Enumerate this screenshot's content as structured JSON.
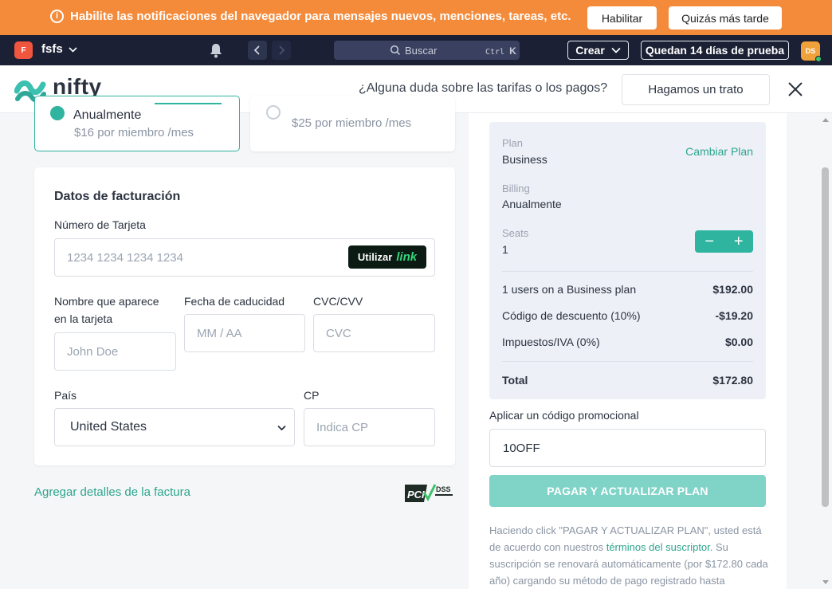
{
  "banner": {
    "icon": "info-icon",
    "message": "Habilite las notificaciones del navegador para mensajes nuevos, menciones, tareas, etc.",
    "enable_label": "Habilitar",
    "later_label": "Quizás más tarde",
    "color": "#f48b3b"
  },
  "topbar": {
    "workspace_initial": "F",
    "workspace_name": "fsfs",
    "search_placeholder": "Buscar",
    "search_shortcut_mod": "Ctrl",
    "search_shortcut_key": "K",
    "create_label": "Crear",
    "trial_label": "Quedan 14 días de prueba",
    "avatar_initials": "DS"
  },
  "header": {
    "logo_text": "nifty",
    "question": "¿Alguna duda sobre las tarifas o los pagos?",
    "deal_label": "Hagamos un trato"
  },
  "plans": {
    "annual": {
      "name": "Anualmente",
      "price": "$16 por miembro /mes",
      "selected": true
    },
    "monthly": {
      "price": "$25 por miembro /mes",
      "selected": false
    }
  },
  "billing": {
    "title": "Datos de facturación",
    "card_label": "Número de Tarjeta",
    "card_placeholder": "1234 1234 1234 1234",
    "link_use": "Utilizar",
    "link_brand": "link",
    "name_label_1": "Nombre que aparece",
    "name_label_2": "en la tarjeta",
    "name_placeholder": "John Doe",
    "expiry_label": "Fecha de caducidad",
    "expiry_placeholder": "MM / AA",
    "cvc_label": "CVC/CVV",
    "cvc_placeholder": "CVC",
    "country_label": "País",
    "country_value": "United States",
    "zip_label": "CP",
    "zip_placeholder": "Indica CP"
  },
  "invoice_link": "Agregar detalles de la factura",
  "pci_badge": {
    "pci": "PCI",
    "dss": "DSS"
  },
  "summary": {
    "plan_label": "Plan",
    "plan_value": "Business",
    "change_plan": "Cambiar Plan",
    "billing_label": "Billing",
    "billing_value": "Anualmente",
    "seats_label": "Seats",
    "seats_value": "1",
    "stepper_minus": "−",
    "stepper_plus": "+",
    "rows": [
      {
        "label": "1 users on a Business plan",
        "value": "$192.00"
      },
      {
        "label": "Código de descuento (10%)",
        "value": "-$19.20"
      },
      {
        "label": "Impuestos/IVA (0%)",
        "value": "$0.00"
      }
    ],
    "total_label": "Total",
    "total_value": "$172.80"
  },
  "promo": {
    "label": "Aplicar un código promocional",
    "value": "10OFF"
  },
  "pay_label": "PAGAR Y ACTUALIZAR PLAN",
  "terms": {
    "prefix": "Haciendo click \"PAGAR Y ACTUALIZAR PLAN\", usted está de acuerdo con nuestros ",
    "link": "términos del suscriptor",
    "suffix": ". Su suscripción se renovará automáticamente (por $172.80 cada año) cargando su método de pago registrado hasta"
  },
  "accent_color": "#2fb4a0"
}
